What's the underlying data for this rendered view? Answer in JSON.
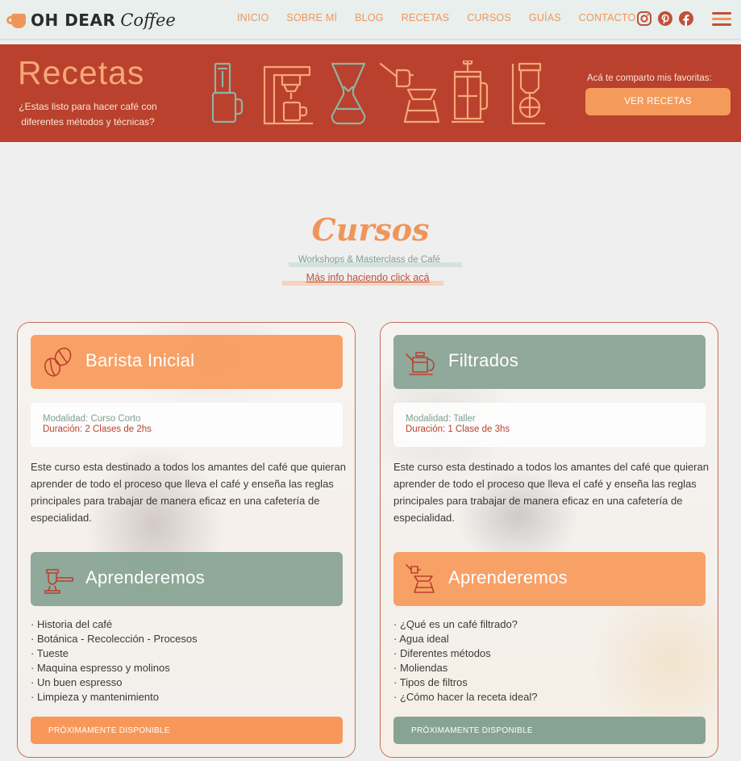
{
  "nav": {
    "logo_text": "OH DEAR",
    "logo_script": "Coffee",
    "menu": [
      "INICIO",
      "SOBRE MÍ",
      "BLOG",
      "RECETAS",
      "CURSOS",
      "GUÍAS",
      "CONTACTO"
    ],
    "social_icons": [
      "instagram-icon",
      "pinterest-icon",
      "facebook-icon"
    ],
    "menu_icon": "hamburger-menu-icon"
  },
  "banner": {
    "title": "Recetas",
    "subtitle": "¿Estas listo para hacer café con diferentes métodos y técnicas?",
    "icons": [
      "aeropress-icon",
      "espresso-machine-icon",
      "chemex-icon",
      "pour-over-kettle-icon",
      "french-press-icon",
      "siphon-icon"
    ],
    "right_text": "Acá te comparto mis favoritas:",
    "button": "VER RECETAS"
  },
  "cursos": {
    "title": "Cursos",
    "subtitle": "Workshops & Masterclass de Café",
    "link": "Más info haciendo click acá"
  },
  "cards": [
    {
      "title": "Barista Inicial",
      "title_icon": "coffee-beans-icon",
      "modalidad": "Modalidad: Curso Corto",
      "duracion": "Duración: 2 Clases de 2hs",
      "description": "Este curso esta destinado a todos los amantes del café que quieran aprender de todo el proceso que lleva el café y enseña las reglas principales para trabajar de manera eficaz en una cafetería de especialidad.",
      "learn_title": "Aprenderemos",
      "learn_icon": "portafilter-icon",
      "learn_items": [
        "· Historia del café",
        "· Botánica - Recolección - Procesos",
        "· Tueste",
        "· Maquina espresso y molinos",
        "· Un buen espresso",
        "· Limpieza y mantenimiento"
      ],
      "button": "PRÓXIMAMENTE DISPONIBLE"
    },
    {
      "title": "Filtrados",
      "title_icon": "kettle-icon",
      "modalidad": "Modalidad: Taller",
      "duracion": "Duración: 1 Clase de 3hs",
      "description": "Este curso esta destinado a todos los amantes del café que quieran aprender de todo el proceso que lleva el café y enseña las reglas principales para trabajar de manera eficaz en una cafetería de especialidad.",
      "learn_title": "Aprenderemos",
      "learn_icon": "pour-over-icon",
      "learn_items": [
        "· ¿Qué es un café filtrado?",
        "· Agua ideal",
        "· Diferentes métodos",
        "· Moliendas",
        "· Tipos de filtros",
        "· ¿Cómo hacer la receta ideal?"
      ],
      "button": "PRÓXIMAMENTE DISPONIBLE"
    }
  ],
  "colors": {
    "brand_orange": "#f0955a",
    "brand_red": "#b9412d",
    "brand_green": "#87a392"
  }
}
